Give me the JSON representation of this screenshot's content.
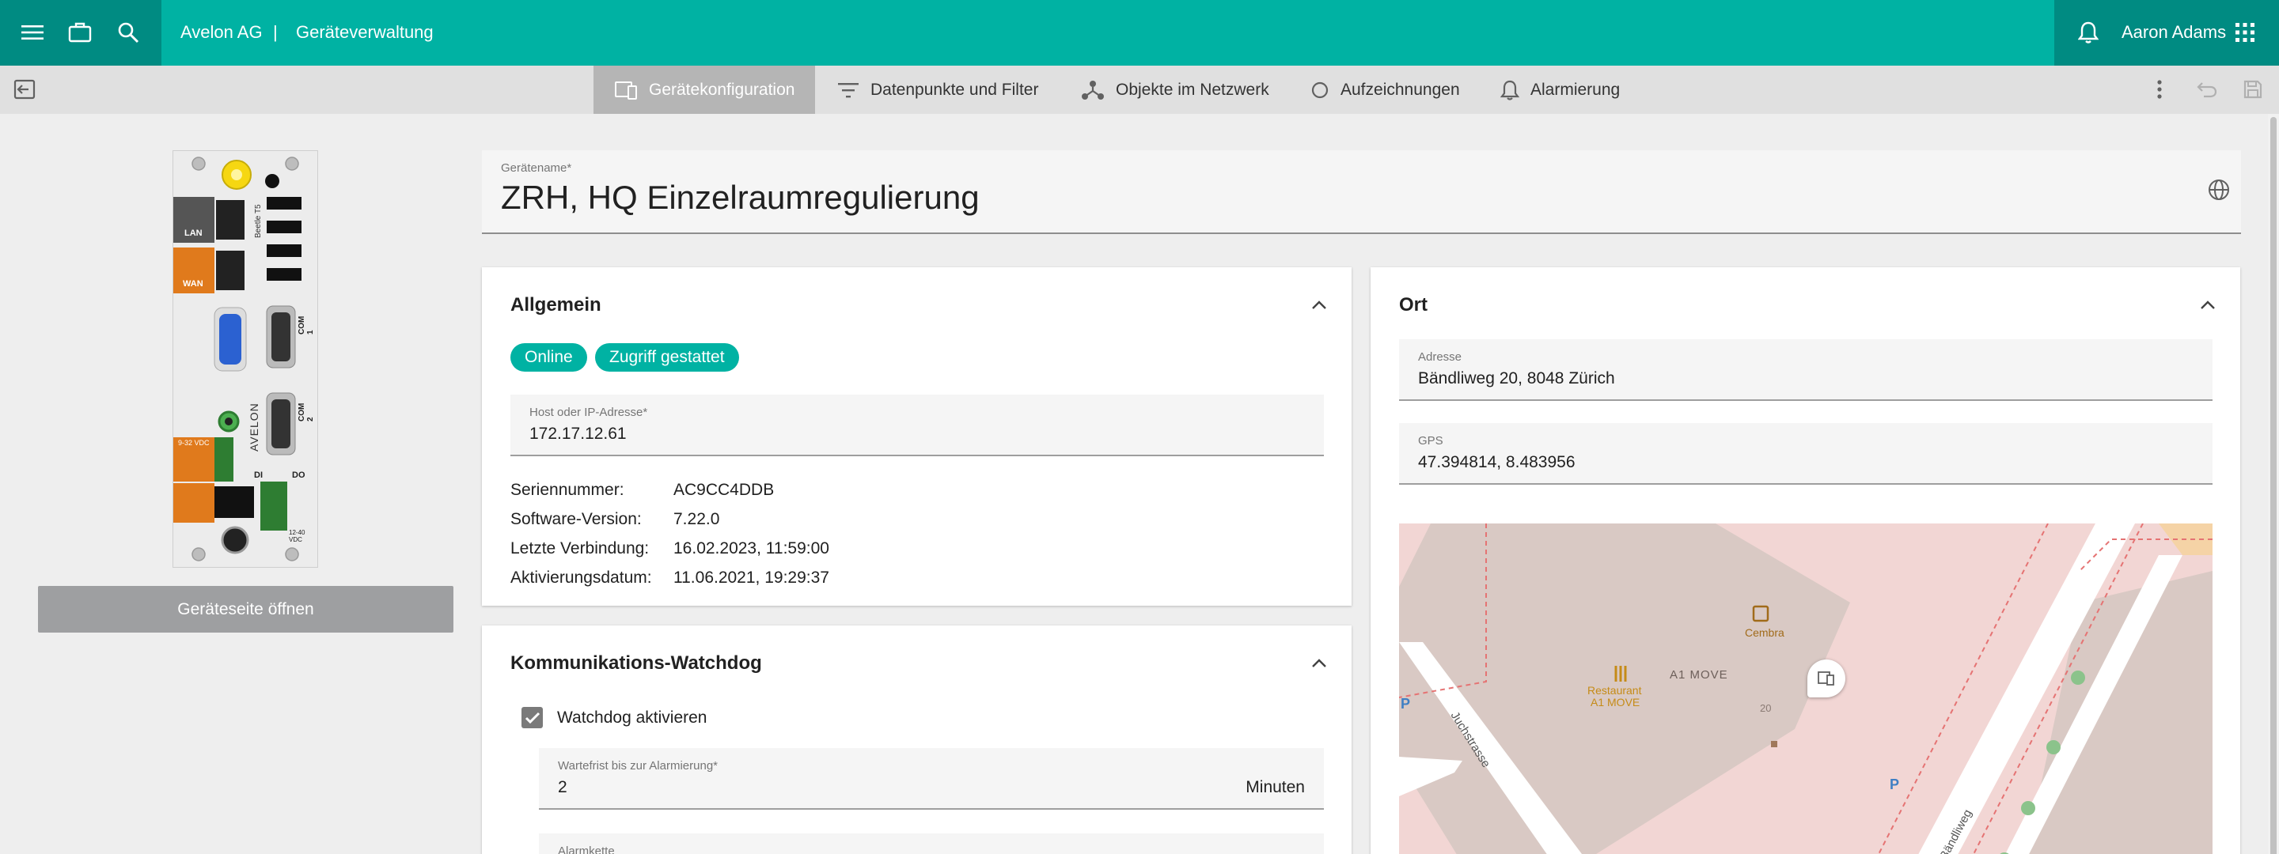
{
  "topbar": {
    "company": "Avelon AG",
    "separator": "|",
    "section": "Geräteverwaltung",
    "user_name": "Aaron Adams",
    "icons": [
      "menu-icon",
      "briefcase-icon",
      "search-icon",
      "bell-icon",
      "apps-grid-icon"
    ]
  },
  "tabs": [
    {
      "label": "Gerätekonfiguration",
      "icon": "device-config-icon",
      "active": true
    },
    {
      "label": "Datenpunkte und Filter",
      "icon": "filter-icon",
      "active": false
    },
    {
      "label": "Objekte im Netzwerk",
      "icon": "network-icon",
      "active": false
    },
    {
      "label": "Aufzeichnungen",
      "icon": "circle-icon",
      "active": false
    },
    {
      "label": "Alarmierung",
      "icon": "bell-icon",
      "active": false
    }
  ],
  "device_panel": {
    "open_button_label": "Geräteseite öffnen",
    "port_labels": {
      "lan": "LAN",
      "wan": "WAN",
      "com1": "COM 1",
      "com2": "COM 2",
      "brand": "AVELON",
      "model": "Beetle T5",
      "di": "DI",
      "do": "DO",
      "power": "9-32 VDC",
      "power_out": "12-40 VDC"
    }
  },
  "device_name": {
    "label": "Gerätename*",
    "value": "ZRH, HQ Einzelraumregulierung"
  },
  "general": {
    "title": "Allgemein",
    "status_chips": [
      "Online",
      "Zugriff gestattet"
    ],
    "host_label": "Host oder IP-Adresse*",
    "host_value": "172.17.12.61",
    "details": [
      {
        "key": "Seriennummer:",
        "value": "AC9CC4DDB"
      },
      {
        "key": "Software-Version:",
        "value": "7.22.0"
      },
      {
        "key": "Letzte Verbindung:",
        "value": "16.02.2023, 11:59:00"
      },
      {
        "key": "Aktivierungsdatum:",
        "value": "11.06.2021, 19:29:37"
      }
    ]
  },
  "watchdog": {
    "title": "Kommunikations-Watchdog",
    "checkbox_label": "Watchdog aktivieren",
    "checked": true,
    "delay_label": "Wartefrist bis zur Alarmierung*",
    "delay_value": "2",
    "delay_unit": "Minuten",
    "chain_label": "Alarmkette"
  },
  "location": {
    "title": "Ort",
    "address_label": "Adresse",
    "address_value": "Bändliweg 20, 8048 Zürich",
    "gps_label": "GPS",
    "gps_value": "47.394814, 8.483956",
    "map_labels": {
      "poi_1": "Cembra",
      "poi_2_line1": "Restaurant",
      "poi_2_line2": "A1 MOVE",
      "building": "A1 MOVE",
      "house_number": "20",
      "street_1": "Juchstrasse",
      "street_2": "Bändliweg"
    }
  },
  "colors": {
    "primary": "#00b2a3",
    "primary_dark": "#008b82",
    "tabbar": "#e0e0e0",
    "active_tab": "#b5b5b5",
    "orange": "#e07a1c"
  }
}
